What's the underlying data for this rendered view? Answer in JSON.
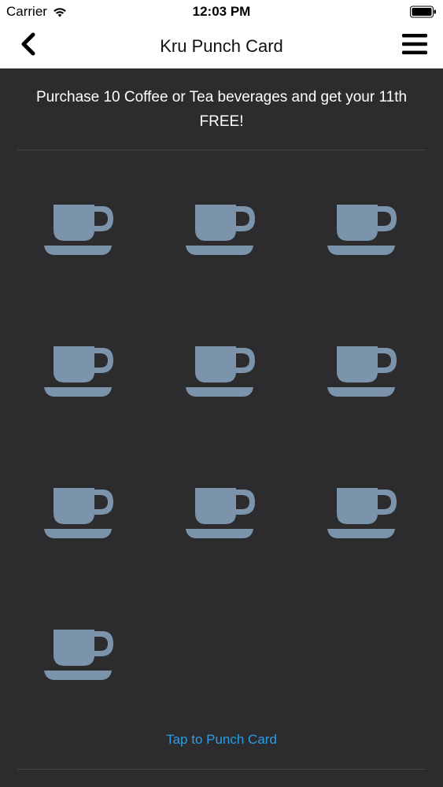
{
  "status_bar": {
    "carrier": "Carrier",
    "time": "12:03 PM",
    "icons": [
      "wifi-icon",
      "battery-icon"
    ]
  },
  "nav": {
    "title": "Kru Punch Card",
    "back_icon": "chevron-left-icon",
    "menu_icon": "hamburger-menu-icon"
  },
  "promo": {
    "text": "Purchase 10 Coffee or Tea beverages and get your 11th FREE!"
  },
  "punch_card": {
    "total_cups": 10,
    "punched": 0,
    "cup_icon": "coffee-cup-icon",
    "cup_color": "#7b93ab"
  },
  "actions": {
    "punch_label": "Tap to Punch Card"
  },
  "colors": {
    "background": "#2c2c2e",
    "accent": "#2b9ee5",
    "text": "#ffffff"
  }
}
